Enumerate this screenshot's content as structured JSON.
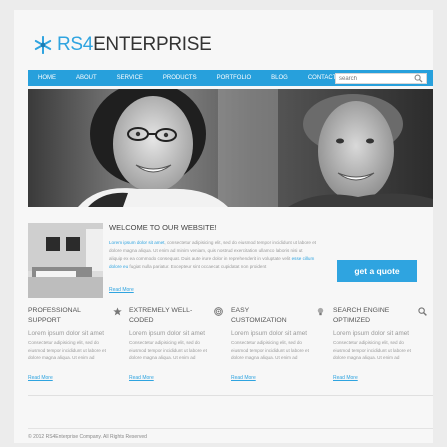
{
  "brand": {
    "name_part1": "RS4",
    "name_part2": "ENTERPRISE",
    "accent": "#2fa4e0"
  },
  "nav": {
    "items": [
      "HOME",
      "ABOUT",
      "SERVICE",
      "PRODUCTS",
      "PORTFOLIO",
      "BLOG",
      "CONTACT"
    ],
    "search_placeholder": "search",
    "search_icon": "search-icon"
  },
  "welcome": {
    "title": "WELCOME TO OUR WEBSITE!",
    "highlight": "Lorem ipsum dolor sit amet",
    "text1": ", consectetur adipisicing elit, sed do eiusmod tempor incididunt ut labore et dolore magna aliqua. Ut enim ad minim veniam, quis nostrud exercitation ullamco laboris nisi ut aliquip ex ea commodo consequat. Duis aute irure dolor in reprehenderit in voluptate velit ",
    "highlight2": "esse cillum dolore eu",
    "text2": " fugiat nulla pariatur. Excepteur sint occaecat cupidatat non proident",
    "read_more": "Read More",
    "quote_button": "get a quote"
  },
  "features": [
    {
      "title": "PROFESSIONAL SUPPORT",
      "icon": "star-icon",
      "subtitle": "Lorem ipsum dolor sit amet",
      "text": "Consectetur adipisicing elit, sed do eiusmod tempor incididunt ut labore et dolore magna aliqua. Ut enim ad",
      "read_more": "Read More"
    },
    {
      "title": "EXTREMELY WELL-CODED",
      "icon": "target-icon",
      "subtitle": "Lorem ipsum dolor sit amet",
      "text": "Consectetur adipisicing elit, sed do eiusmod tempor incididunt ut labore et dolore magna aliqua. Ut enim ad",
      "read_more": "Read More"
    },
    {
      "title": "EASY CUSTOMIZATION",
      "icon": "lightbulb-icon",
      "subtitle": "Lorem ipsum dolor sit amet",
      "text": "Consectetur adipisicing elit, sed do eiusmod tempor incididunt ut labore et dolore magna aliqua. Ut enim ad",
      "read_more": "Read More"
    },
    {
      "title": "SEARCH ENGINE OPTIMIZED",
      "icon": "magnifier-icon",
      "subtitle": "Lorem ipsum dolor sit amet",
      "text": "Consectetur adipisicing elit, sed do eiusmod tempor incididunt ut labore et dolore magna aliqua. Ut enim ad",
      "read_more": "Read More"
    }
  ],
  "footer": {
    "copyright": "© 2012 RS4Enterprise Company. All Rights Reserved"
  }
}
